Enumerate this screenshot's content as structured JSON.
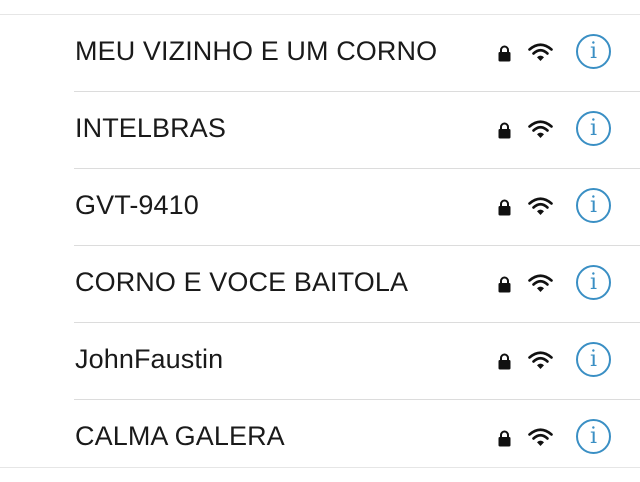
{
  "wifi_networks": [
    {
      "name": "MEU VIZINHO E UM CORNO",
      "secured_icon": "lock-icon",
      "signal_icon": "wifi-icon",
      "info_label": "i"
    },
    {
      "name": "INTELBRAS",
      "secured_icon": "lock-icon",
      "signal_icon": "wifi-icon",
      "info_label": "i"
    },
    {
      "name": "GVT-9410",
      "secured_icon": "lock-icon",
      "signal_icon": "wifi-icon",
      "info_label": "i"
    },
    {
      "name": "CORNO E VOCE BAITOLA",
      "secured_icon": "lock-icon",
      "signal_icon": "wifi-icon",
      "info_label": "i"
    },
    {
      "name": "JohnFaustin",
      "secured_icon": "lock-icon",
      "signal_icon": "wifi-icon",
      "info_label": "i"
    },
    {
      "name": "CALMA GALERA",
      "secured_icon": "lock-icon",
      "signal_icon": "wifi-icon",
      "info_label": "i"
    }
  ],
  "colors": {
    "text": "#1a1a1a",
    "accent": "#3a8fc4",
    "separator": "#dcdcdc"
  }
}
